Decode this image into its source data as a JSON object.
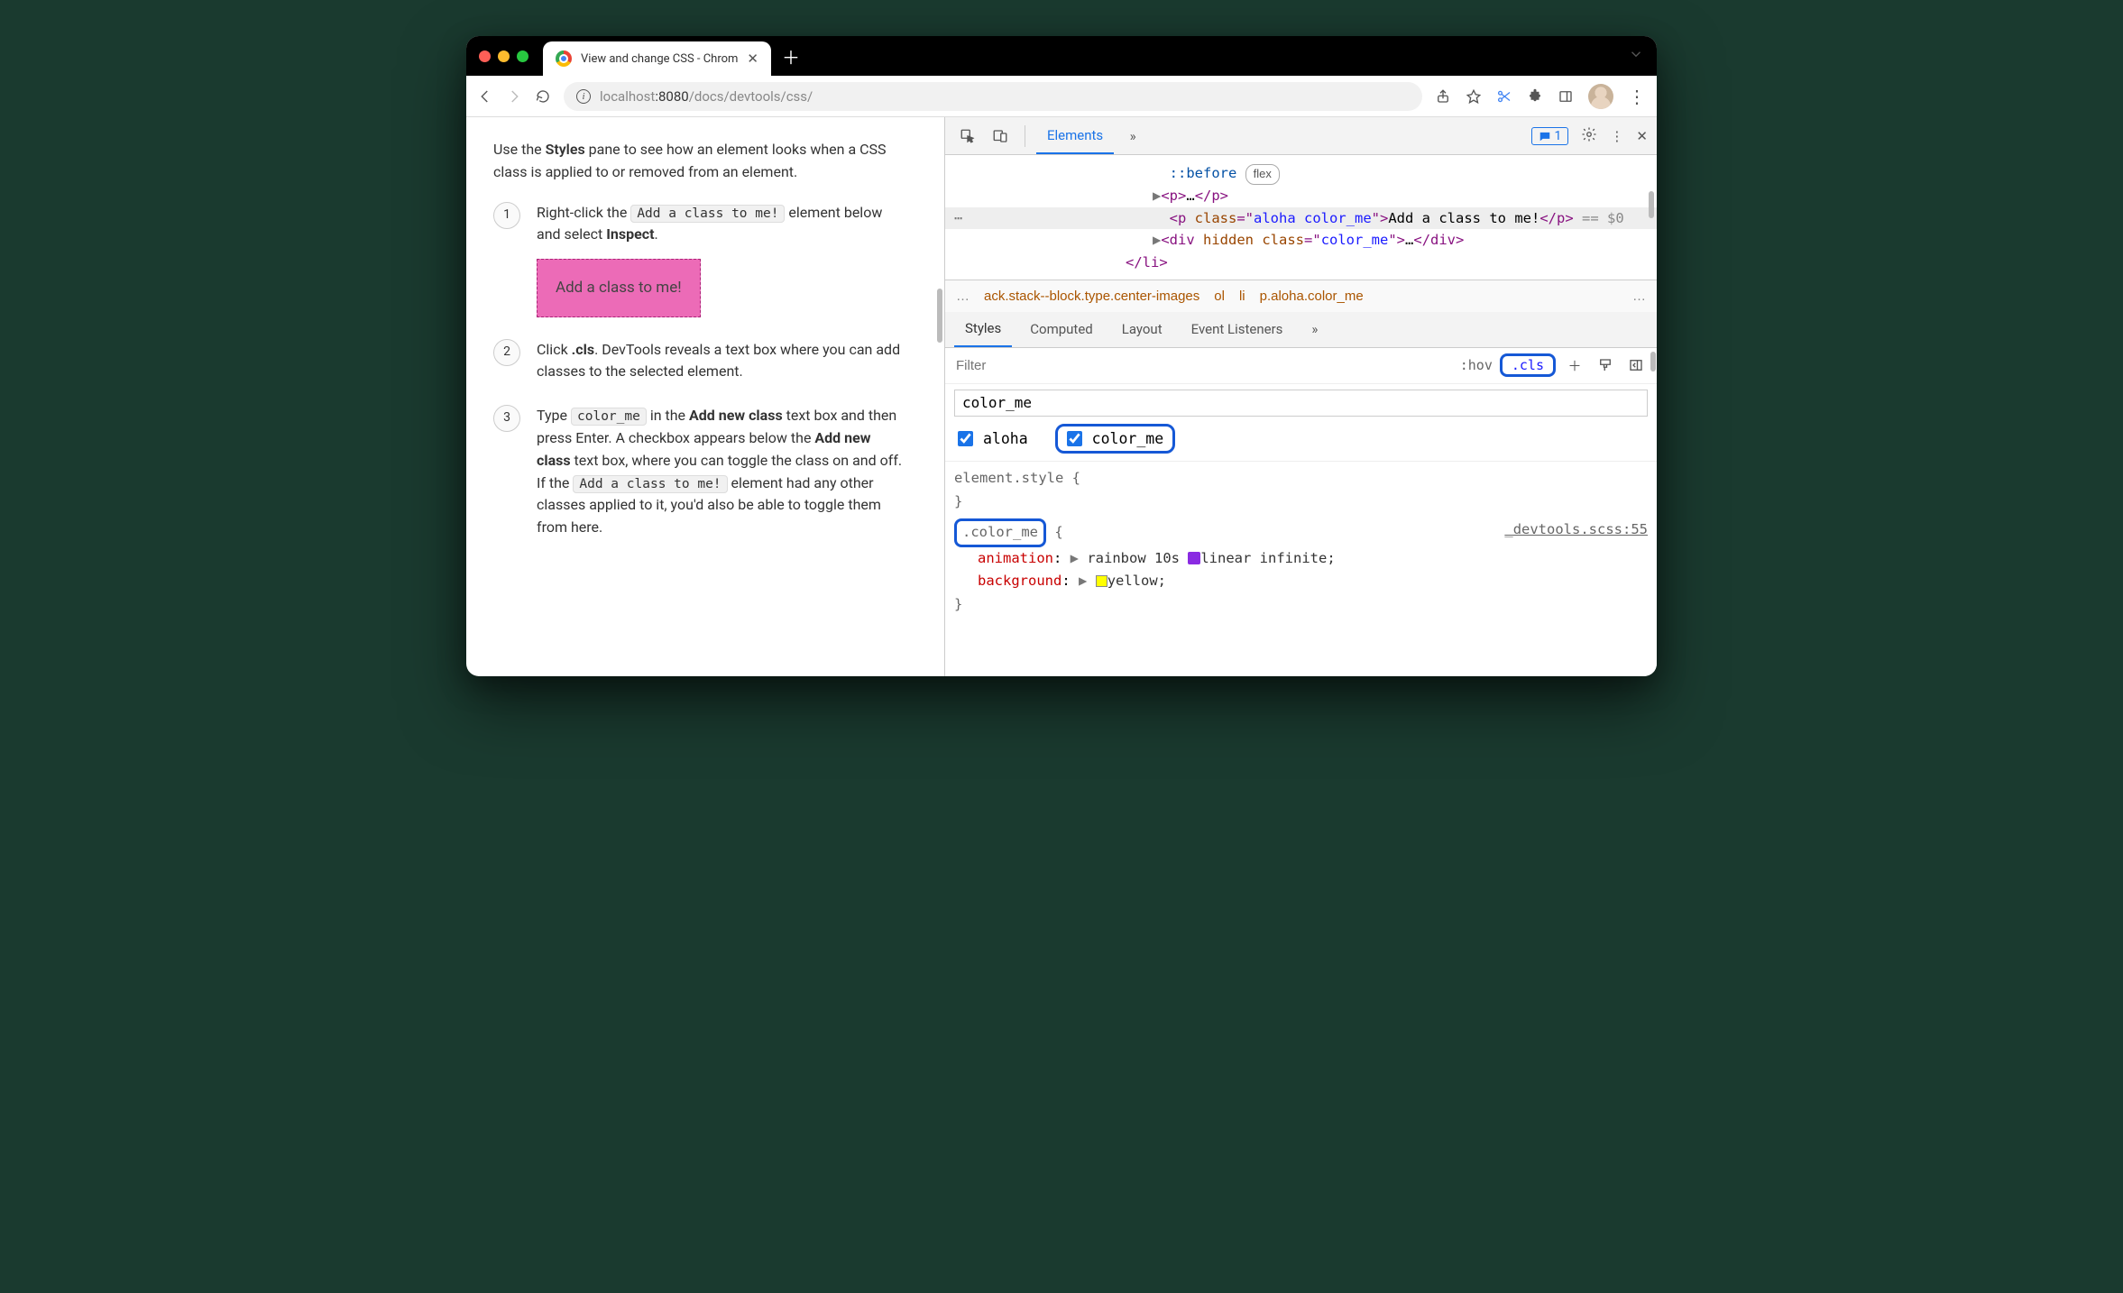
{
  "tab": {
    "title": "View and change CSS - Chrom"
  },
  "url": {
    "host_light1": "localhost",
    "port": ":8080",
    "path": "/docs/devtools/css/"
  },
  "page": {
    "intro_pre": "Use the ",
    "intro_b": "Styles",
    "intro_post": " pane to see how an element looks when a CSS class is applied to or removed from an element.",
    "s1_a": "Right-click the ",
    "s1_code": "Add a class to me!",
    "s1_b": " element below and select ",
    "s1_bold": "Inspect",
    "s1_c": ".",
    "demo": "Add a class to me!",
    "s2_a": "Click ",
    "s2_bold": ".cls",
    "s2_b": ". DevTools reveals a text box where you can add classes to the selected element.",
    "s3_a": "Type ",
    "s3_code1": "color_me",
    "s3_b": " in the ",
    "s3_bold1": "Add new class",
    "s3_c": " text box and then press Enter. A checkbox appears below the ",
    "s3_bold2": "Add new class",
    "s3_d": " text box, where you can toggle the class on and off. If the ",
    "s3_code2": "Add a class to me!",
    "s3_e": " element had any other classes applied to it, you'd also be able to toggle them from here."
  },
  "dt": {
    "tab_elements": "Elements",
    "badge_count": "1",
    "dom_before": "::before",
    "dom_flex": "flex",
    "dom_p_open": "<p>",
    "dom_p_ellipsis": "…",
    "dom_p_close": "</p>",
    "dom_hl_open1": "<p ",
    "dom_hl_attr": "class",
    "dom_hl_eq": "=\"",
    "dom_hl_val": "aloha color_me",
    "dom_hl_close1": "\">",
    "dom_hl_text": "Add a class to me!",
    "dom_hl_close2": "</p>",
    "dom_hl_eq0": " == $0",
    "dom_div_open": "<div ",
    "dom_div_hidden": "hidden ",
    "dom_div_class": "class",
    "dom_div_val": "color_me",
    "dom_div_mid": "…",
    "dom_div_close": "</div>",
    "dom_li_close": "</li>",
    "crumb_dots": "…",
    "crumb_stack": "ack.stack--block.type.center-images",
    "crumb_ol": "ol",
    "crumb_li": "li",
    "crumb_p": "p.aloha.color_me",
    "crumb_dots2": "…",
    "sub_styles": "Styles",
    "sub_computed": "Computed",
    "sub_layout": "Layout",
    "sub_events": "Event Listeners",
    "filter_ph": "Filter",
    "hov": ":hov",
    "cls": ".cls",
    "cls_input": "color_me",
    "chk1": "aloha",
    "chk2": "color_me",
    "rule_elstyle": "element.style {",
    "brace_close": "}",
    "rule_sel": ".color_me",
    "rule_brace": " {",
    "rule_src": "_devtools.scss:55",
    "prop_anim": "animation",
    "val_anim1": " rainbow 10s ",
    "val_anim2": "linear infinite;",
    "prop_bg": "background",
    "val_bg": "yellow;"
  }
}
